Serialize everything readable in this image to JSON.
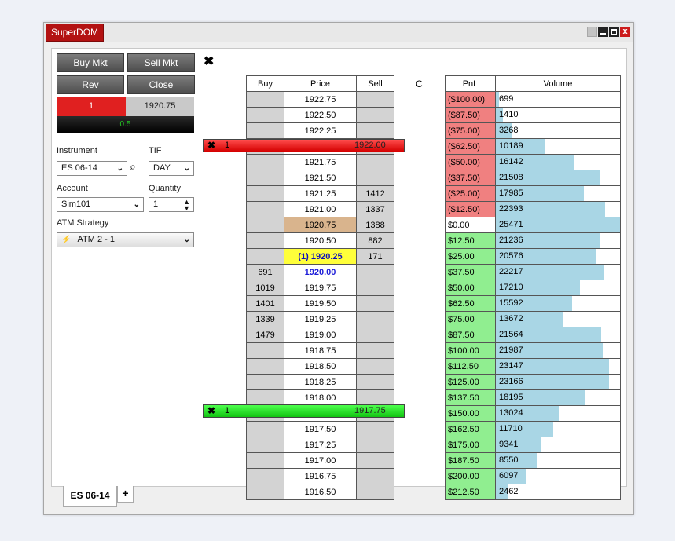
{
  "window": {
    "title": "SuperDOM",
    "min": "",
    "max": "",
    "close": "x"
  },
  "buttons": {
    "buy_mkt": "Buy Mkt",
    "sell_mkt": "Sell Mkt",
    "rev": "Rev",
    "close": "Close"
  },
  "position": {
    "qty": "1",
    "avg_price": "1920.75",
    "pnl": "0.5"
  },
  "labels": {
    "instrument": "Instrument",
    "tif": "TIF",
    "account": "Account",
    "quantity": "Quantity",
    "atm_strategy": "ATM Strategy"
  },
  "fields": {
    "instrument": "ES 06-14",
    "tif": "DAY",
    "account": "Sim101",
    "quantity": "1",
    "atm_strategy": "ATM 2 - 1"
  },
  "icons": {
    "search": "⌕",
    "lightning": "⚡",
    "close_x": "✖"
  },
  "ladder": {
    "headers": {
      "buy": "Buy",
      "price": "Price",
      "sell": "Sell",
      "c": "C",
      "pnl": "PnL",
      "volume": "Volume"
    },
    "rows": [
      {
        "buy": "",
        "price": "1922.75",
        "sell": "",
        "pnl": "($100.00)",
        "vol": "699",
        "volpct": 0.025
      },
      {
        "buy": "",
        "price": "1922.50",
        "sell": "",
        "pnl": "($87.50)",
        "vol": "1410",
        "volpct": 0.055
      },
      {
        "buy": "",
        "price": "1922.25",
        "sell": "",
        "pnl": "($75.00)",
        "vol": "3268",
        "volpct": 0.13
      },
      {
        "buy": "",
        "price": "1922.00",
        "sell": "",
        "pnl": "($62.50)",
        "vol": "10189",
        "volpct": 0.4
      },
      {
        "buy": "",
        "price": "1921.75",
        "sell": "",
        "pnl": "($50.00)",
        "vol": "16142",
        "volpct": 0.634
      },
      {
        "buy": "",
        "price": "1921.50",
        "sell": "",
        "pnl": "($37.50)",
        "vol": "21508",
        "volpct": 0.844
      },
      {
        "buy": "",
        "price": "1921.25",
        "sell": "1412",
        "pnl": "($25.00)",
        "vol": "17985",
        "volpct": 0.706
      },
      {
        "buy": "",
        "price": "1921.00",
        "sell": "1337",
        "pnl": "($12.50)",
        "vol": "22393",
        "volpct": 0.879
      },
      {
        "buy": "",
        "price": "1920.75",
        "sell": "1388",
        "pnl": "$0.00",
        "vol": "25471",
        "volpct": 1.0
      },
      {
        "buy": "",
        "price": "1920.50",
        "sell": "882",
        "pnl": "$12.50",
        "vol": "21236",
        "volpct": 0.834
      },
      {
        "buy": "",
        "price": "(1) 1920.25",
        "sell": "171",
        "pnl": "$25.00",
        "vol": "20576",
        "volpct": 0.808
      },
      {
        "buy": "691",
        "price": "1920.00",
        "sell": "",
        "pnl": "$37.50",
        "vol": "22217",
        "volpct": 0.872
      },
      {
        "buy": "1019",
        "price": "1919.75",
        "sell": "",
        "pnl": "$50.00",
        "vol": "17210",
        "volpct": 0.676
      },
      {
        "buy": "1401",
        "price": "1919.50",
        "sell": "",
        "pnl": "$62.50",
        "vol": "15592",
        "volpct": 0.612
      },
      {
        "buy": "1339",
        "price": "1919.25",
        "sell": "",
        "pnl": "$75.00",
        "vol": "13672",
        "volpct": 0.537
      },
      {
        "buy": "1479",
        "price": "1919.00",
        "sell": "",
        "pnl": "$87.50",
        "vol": "21564",
        "volpct": 0.847
      },
      {
        "buy": "",
        "price": "1918.75",
        "sell": "",
        "pnl": "$100.00",
        "vol": "21987",
        "volpct": 0.863
      },
      {
        "buy": "",
        "price": "1918.50",
        "sell": "",
        "pnl": "$112.50",
        "vol": "23147",
        "volpct": 0.909
      },
      {
        "buy": "",
        "price": "1918.25",
        "sell": "",
        "pnl": "$125.00",
        "vol": "23166",
        "volpct": 0.909
      },
      {
        "buy": "",
        "price": "1918.00",
        "sell": "",
        "pnl": "$137.50",
        "vol": "18195",
        "volpct": 0.714
      },
      {
        "buy": "",
        "price": "1917.75",
        "sell": "",
        "pnl": "$150.00",
        "vol": "13024",
        "volpct": 0.511
      },
      {
        "buy": "",
        "price": "1917.50",
        "sell": "",
        "pnl": "$162.50",
        "vol": "11710",
        "volpct": 0.46
      },
      {
        "buy": "",
        "price": "1917.25",
        "sell": "",
        "pnl": "$175.00",
        "vol": "9341",
        "volpct": 0.367
      },
      {
        "buy": "",
        "price": "1917.00",
        "sell": "",
        "pnl": "$187.50",
        "vol": "8550",
        "volpct": 0.336
      },
      {
        "buy": "",
        "price": "1916.75",
        "sell": "",
        "pnl": "$200.00",
        "vol": "6097",
        "volpct": 0.239
      },
      {
        "buy": "",
        "price": "1916.50",
        "sell": "",
        "pnl": "$212.50",
        "vol": "2462",
        "volpct": 0.097
      }
    ],
    "sell_order": {
      "qty": "1",
      "price": "1922.00"
    },
    "buy_order": {
      "qty": "1",
      "price": "1917.75"
    }
  },
  "colors": {
    "sell_order": "#e21a1a",
    "buy_order": "#1ed81e",
    "pnl_negative": "#f08080",
    "pnl_positive": "#90ee90",
    "volume_bar": "#a9d6e5",
    "last_price": "#ffff3a",
    "avg_price": "#d9b48d"
  },
  "tabs": {
    "active": "ES 06-14",
    "add": "+"
  }
}
